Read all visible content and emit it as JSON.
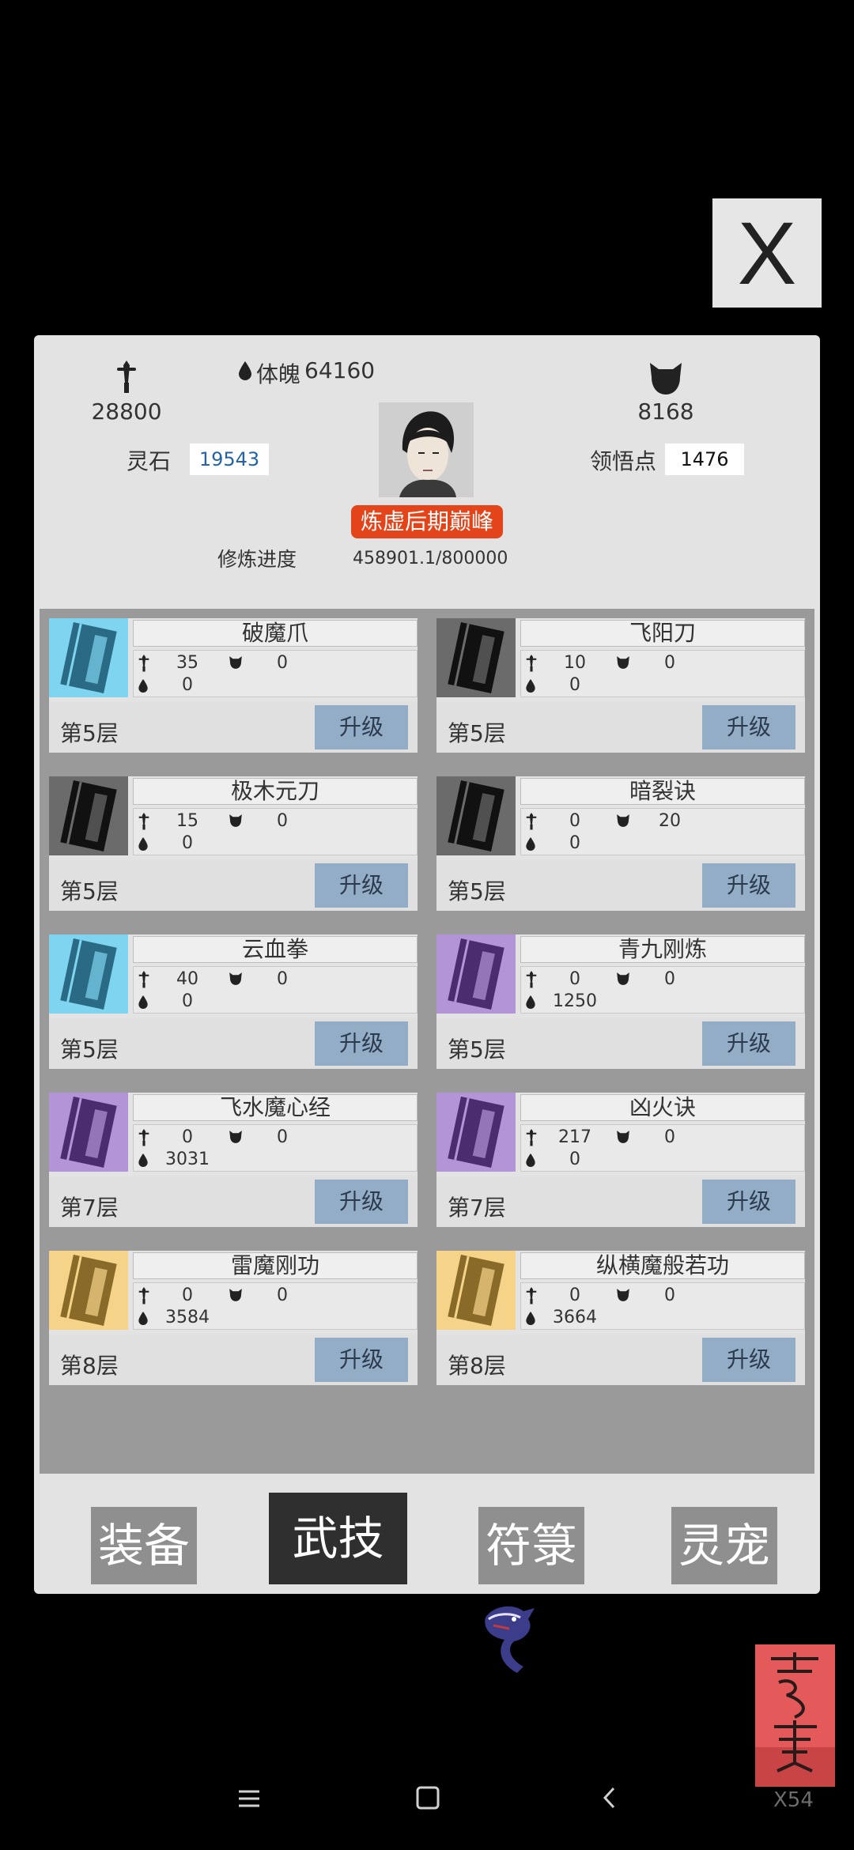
{
  "close_label": "X",
  "header": {
    "attack_value": "28800",
    "physique_label": "体魄",
    "physique_value": "64160",
    "defense_value": "8168",
    "spirit_stone_label": "灵石",
    "spirit_stone_value": "19543",
    "insight_label": "领悟点",
    "insight_value": "1476",
    "realm": "炼虚后期巅峰",
    "progress_label": "修炼进度",
    "progress_value": "458901.1/800000"
  },
  "skills": [
    {
      "name": "破魔爪",
      "atk": "35",
      "def": "0",
      "hp": "0",
      "level": "第5层",
      "upgrade": "升级",
      "color": "#7fd4f0",
      "dark": "#2a6a84"
    },
    {
      "name": "飞阳刀",
      "atk": "10",
      "def": "0",
      "hp": "0",
      "level": "第5层",
      "upgrade": "升级",
      "color": "#6b6b6b",
      "dark": "#111111"
    },
    {
      "name": "极木元刀",
      "atk": "15",
      "def": "0",
      "hp": "0",
      "level": "第5层",
      "upgrade": "升级",
      "color": "#6b6b6b",
      "dark": "#111111"
    },
    {
      "name": "暗裂诀",
      "atk": "0",
      "def": "20",
      "hp": "0",
      "level": "第5层",
      "upgrade": "升级",
      "color": "#6b6b6b",
      "dark": "#111111"
    },
    {
      "name": "云血拳",
      "atk": "40",
      "def": "0",
      "hp": "0",
      "level": "第5层",
      "upgrade": "升级",
      "color": "#7fd4f0",
      "dark": "#2a6a84"
    },
    {
      "name": "青九刚炼",
      "atk": "0",
      "def": "0",
      "hp": "1250",
      "level": "第5层",
      "upgrade": "升级",
      "color": "#b394d6",
      "dark": "#4b2c6e"
    },
    {
      "name": "飞水魔心经",
      "atk": "0",
      "def": "0",
      "hp": "3031",
      "level": "第7层",
      "upgrade": "升级",
      "color": "#b394d6",
      "dark": "#4b2c6e"
    },
    {
      "name": "凶火诀",
      "atk": "217",
      "def": "0",
      "hp": "0",
      "level": "第7层",
      "upgrade": "升级",
      "color": "#b394d6",
      "dark": "#4b2c6e"
    },
    {
      "name": "雷魔刚功",
      "atk": "0",
      "def": "0",
      "hp": "3584",
      "level": "第8层",
      "upgrade": "升级",
      "color": "#f5d48a",
      "dark": "#8a6a28"
    },
    {
      "name": "纵横魔般若功",
      "atk": "0",
      "def": "0",
      "hp": "3664",
      "level": "第8层",
      "upgrade": "升级",
      "color": "#f5d48a",
      "dark": "#8a6a28"
    }
  ],
  "tabs": [
    {
      "label": "装备",
      "active": false
    },
    {
      "label": "武技",
      "active": true
    },
    {
      "label": "符箓",
      "active": false
    },
    {
      "label": "灵宠",
      "active": false
    }
  ],
  "corner_counter": "X54",
  "icons": {
    "attack": "sword-icon",
    "physique": "drop-icon",
    "defense": "beast-icon"
  }
}
